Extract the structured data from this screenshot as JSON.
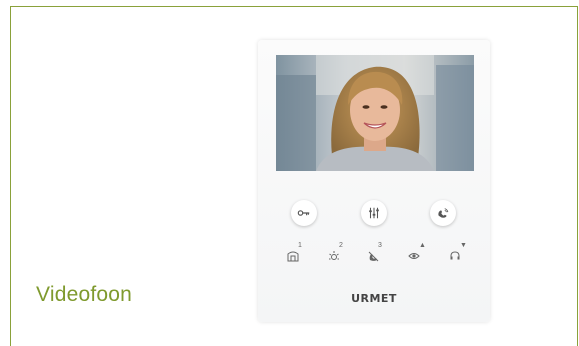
{
  "caption": "Videofoon",
  "device": {
    "brand": "URMET",
    "buttons": [
      {
        "icon": "key-icon"
      },
      {
        "icon": "menu-sliders-icon"
      },
      {
        "icon": "handset-icon"
      }
    ],
    "indicators": [
      {
        "icon": "door-icon",
        "label": "1"
      },
      {
        "icon": "light-icon",
        "label": "2"
      },
      {
        "icon": "mute-icon",
        "label": "3"
      },
      {
        "icon": "eye-icon",
        "label": "▲"
      },
      {
        "icon": "headset-icon",
        "label": "▼"
      }
    ]
  },
  "colors": {
    "accent": "#7f9a2e",
    "border": "#8aa13a"
  }
}
